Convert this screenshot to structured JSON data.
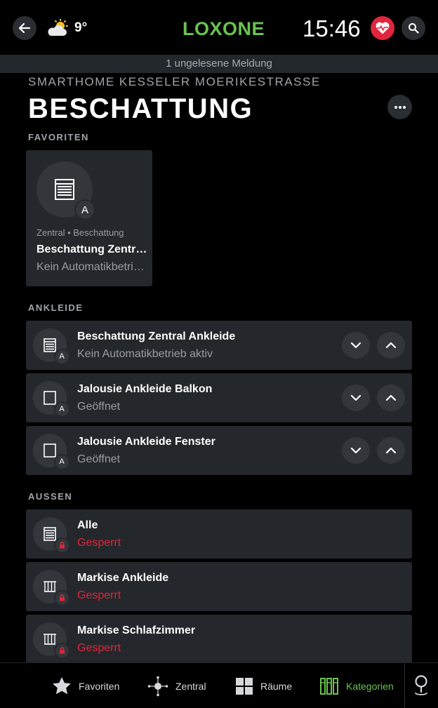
{
  "topbar": {
    "temperature": "9°",
    "logo": "LOXONE",
    "time": "15:46"
  },
  "notice": "1 ungelesene Meldung",
  "subtitle": "SMARTHOME KESSELER MOERIKESTRASSE",
  "title": "BESCHATTUNG",
  "sections": {
    "favoriten": "FAVORITEN",
    "ankleide": "ANKLEIDE",
    "aussen": "AUSSEN"
  },
  "favorite": {
    "badge": "A",
    "subtitle": "Zentral • Beschattung",
    "name": "Beschattung Zentral Ankleide",
    "state": "Kein Automatikbetrieb aktiv"
  },
  "ankleide": [
    {
      "name": "Beschattung Zentral Ankleide",
      "state": "Kein Automatikbetrieb aktiv",
      "badge": "A",
      "icon": "blind-closed-icon"
    },
    {
      "name": "Jalousie Ankleide Balkon",
      "state": "Geöffnet",
      "badge": "A",
      "icon": "blind-open-icon"
    },
    {
      "name": "Jalousie Ankleide Fenster",
      "state": "Geöffnet",
      "badge": "A",
      "icon": "blind-open-icon"
    }
  ],
  "aussen": [
    {
      "name": "Alle",
      "state": "Gesperrt",
      "icon": "blind-closed-icon"
    },
    {
      "name": "Markise Ankleide",
      "state": "Gesperrt",
      "icon": "awning-icon"
    },
    {
      "name": "Markise Schlafzimmer",
      "state": "Gesperrt",
      "icon": "awning-icon"
    }
  ],
  "tabs": {
    "favoriten": "Favoriten",
    "zentral": "Zentral",
    "raeume": "Räume",
    "kategorien": "Kategorien"
  },
  "colors": {
    "accent": "#69c350",
    "locked": "#e0263d",
    "card": "#24272b"
  }
}
